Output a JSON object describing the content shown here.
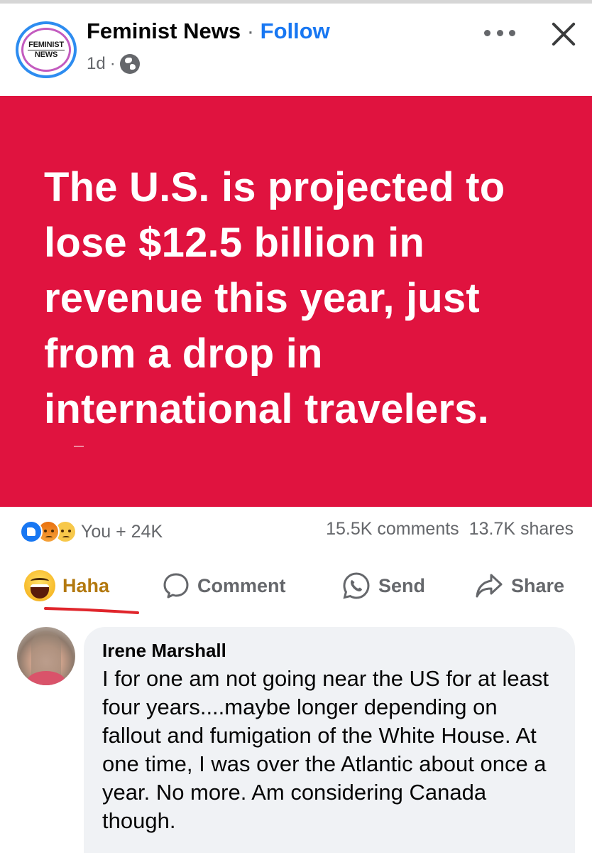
{
  "post": {
    "page_avatar_lines": [
      "FEMINIST",
      "NEWS"
    ],
    "page_name": "Feminist News",
    "separator": "·",
    "follow_label": "Follow",
    "time": "1d",
    "time_separator": "·",
    "privacy_icon": "globe-icon",
    "menu_icon": "more-icon",
    "close_icon": "close-icon",
    "image_background": "#e0133f",
    "image_text": "The U.S. is projected to lose $12.5 billion in revenue this year, just from a drop in international travelers."
  },
  "summary": {
    "reaction_icons": [
      "like",
      "angry",
      "sad"
    ],
    "reaction_count": "You + 24K",
    "comments": "15.5K comments",
    "shares": "13.7K shares"
  },
  "actions": {
    "haha": "Haha",
    "comment": "Comment",
    "send": "Send",
    "share": "Share"
  },
  "comment": {
    "name": "Irene Marshall",
    "text": "I for one am not going near the US for at least four years....maybe longer depending on fallout and fumigation of the White House. At one time, I was over the Atlantic about once a year. No more. Am considering Canada though."
  },
  "colors": {
    "accent": "#1877f2",
    "haha": "#b3790f",
    "underline": "#e0252b"
  }
}
